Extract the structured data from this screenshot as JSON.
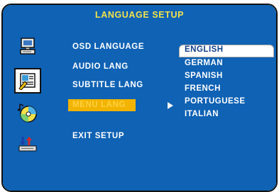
{
  "header": {
    "title": "LANGUAGE SETUP"
  },
  "sidebar": {
    "items": [
      {
        "icon": "monitor-icon"
      },
      {
        "icon": "settings-document-icon",
        "selected": true
      },
      {
        "icon": "audio-disc-icon"
      },
      {
        "icon": "sort-arrows-icon"
      }
    ]
  },
  "menu": {
    "items": [
      {
        "label": "OSD LANGUAGE"
      },
      {
        "label": "AUDIO LANG"
      },
      {
        "label": "SUBTITLE LANG"
      },
      {
        "label": "MENU LANG",
        "highlighted": true
      },
      {
        "label": "EXIT SETUP"
      }
    ]
  },
  "options": {
    "items": [
      "ENGLISH",
      "GERMAN",
      "SPANISH",
      "FRENCH",
      "PORTUGUESE",
      "ITALIAN"
    ],
    "current": "ENGLISH"
  },
  "colors": {
    "background": "#0f62b4",
    "header_text": "#f2e34b",
    "highlight_bg": "#f2b400",
    "highlight_text": "#ffcf40",
    "text": "#ffffff"
  }
}
